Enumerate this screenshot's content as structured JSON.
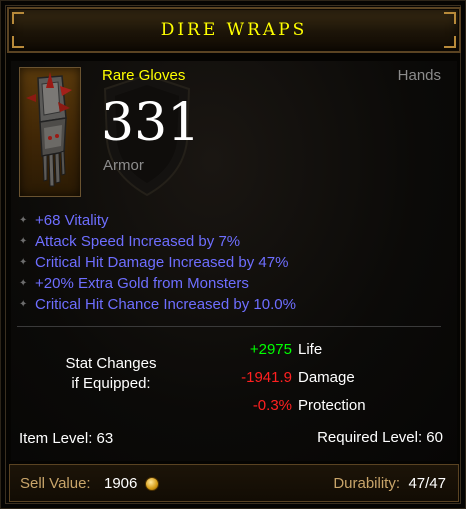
{
  "item": {
    "name": "DIRE WRAPS",
    "rarity_type": "Rare Gloves",
    "slot": "Hands",
    "armor_value": "331",
    "armor_label": "Armor",
    "icon": "gauntlet-icon"
  },
  "affixes": [
    "+68 Vitality",
    "Attack Speed Increased by 7%",
    "Critical Hit Damage Increased by 47%",
    "+20% Extra Gold from Monsters",
    "Critical Hit Chance Increased by 10.0%"
  ],
  "stat_changes": {
    "label_line1": "Stat Changes",
    "label_line2": "if Equipped:",
    "rows": [
      {
        "value": "+2975",
        "label": "Life",
        "polarity": "positive"
      },
      {
        "value": "-1941.9",
        "label": "Damage",
        "polarity": "negative"
      },
      {
        "value": "-0.3%",
        "label": "Protection",
        "polarity": "negative"
      }
    ]
  },
  "levels": {
    "item_level": "Item Level: 63",
    "required_level": "Required Level: 60"
  },
  "footer": {
    "sell_label": "Sell Value:",
    "sell_value": "1906",
    "currency_icon": "gold-coin-icon",
    "durability_label": "Durability:",
    "durability_value": "47/47"
  },
  "colors": {
    "name": "#ffff00",
    "affix": "#6e6eff",
    "positive": "#00ff00",
    "negative": "#ff2020",
    "footer_label": "#c9a56a"
  }
}
